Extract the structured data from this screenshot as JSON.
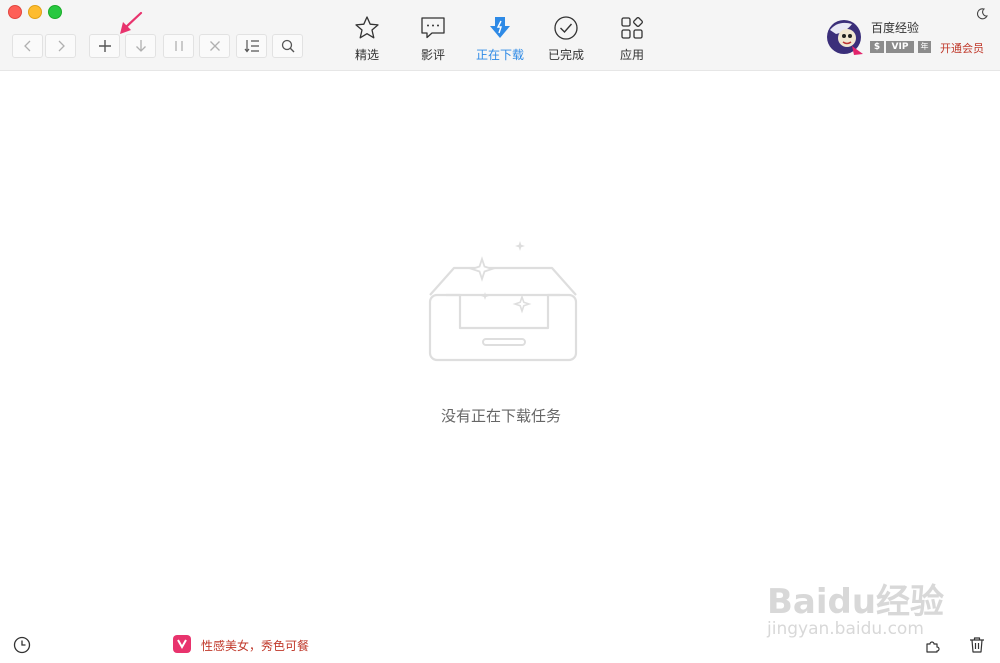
{
  "toolbar": {
    "nav_tabs": [
      {
        "label": "精选",
        "icon": "star-icon",
        "active": false
      },
      {
        "label": "影评",
        "icon": "comment-icon",
        "active": false
      },
      {
        "label": "正在下载",
        "icon": "download-icon",
        "active": true
      },
      {
        "label": "已完成",
        "icon": "check-circle-icon",
        "active": false
      },
      {
        "label": "应用",
        "icon": "apps-icon",
        "active": false
      }
    ],
    "buttons": [
      "back-icon",
      "forward-icon",
      "add-icon",
      "download-arrow-icon",
      "pause-icon",
      "close-icon",
      "sort-icon",
      "search-icon"
    ]
  },
  "user": {
    "name": "百度经验",
    "badge_s": "$",
    "badge_vip": "VIP",
    "badge_year": "年",
    "member_link": "开通会员"
  },
  "main": {
    "empty_text": "没有正在下载任务"
  },
  "footer": {
    "promo_text": "性感美女，秀色可餐"
  },
  "watermark": {
    "brand": "Baidu经验",
    "url": "jingyan.baidu.com"
  },
  "colors": {
    "accent": "#2e8ae6",
    "promo": "#c0392b",
    "annotation_arrow": "#e8336d"
  }
}
